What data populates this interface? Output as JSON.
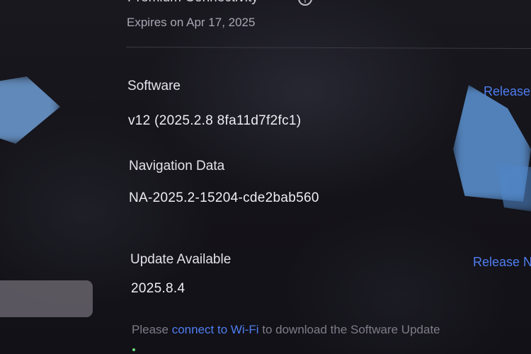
{
  "connectivity": {
    "title": "Premium Connectivity",
    "expires": "Expires on Apr 17, 2025",
    "info_icon": "info-icon"
  },
  "software": {
    "label": "Software",
    "version": "v12 (2025.2.8 8fa11d7f2fc1)",
    "release_notes": "Release"
  },
  "navigation": {
    "label": "Navigation Data",
    "version": "NA-2025.2-15204-cde2bab560"
  },
  "update": {
    "label": "Update Available",
    "version": "2025.8.4",
    "release_notes": "Release N"
  },
  "prompt": {
    "before": "Please ",
    "link": "connect to Wi-Fi",
    "after": " to download the Software Update"
  },
  "colors": {
    "link": "#4f7df0",
    "background": "#15141a",
    "muted_text": "#7e7c88"
  }
}
